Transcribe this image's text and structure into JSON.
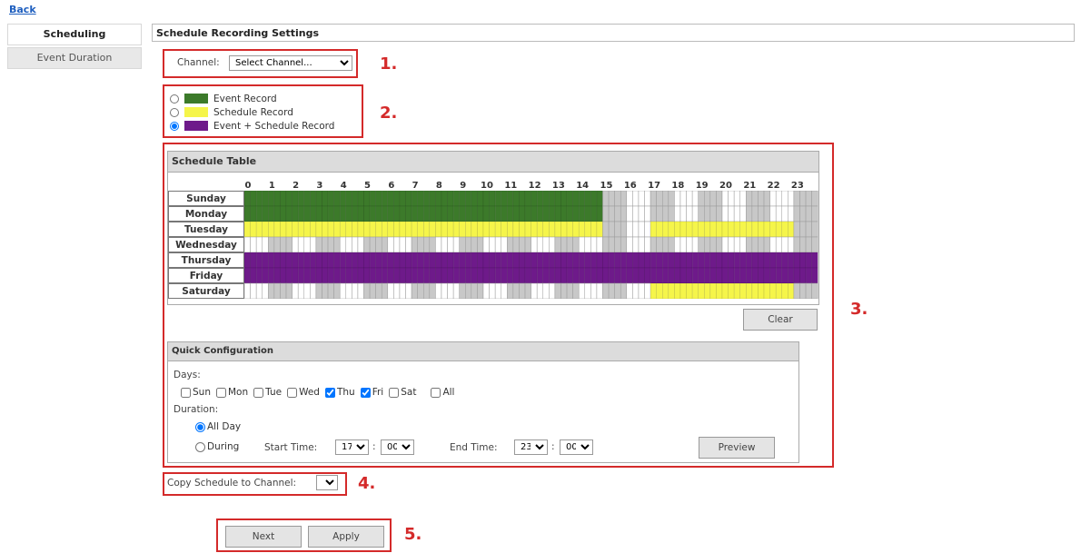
{
  "nav": {
    "back_label": "Back"
  },
  "sidebar": {
    "items": [
      {
        "label": "Scheduling",
        "active": true
      },
      {
        "label": "Event Duration",
        "active": false
      }
    ]
  },
  "page_title": "Schedule Recording Settings",
  "channel": {
    "label": "Channel:",
    "selected": "Select Channel..."
  },
  "legend": {
    "items": [
      {
        "label": "Event Record",
        "color": "#3c7a2a",
        "selected": false
      },
      {
        "label": "Schedule Record",
        "color": "#f5f54a",
        "selected": false
      },
      {
        "label": "Event + Schedule Record",
        "color": "#6e1a8a",
        "selected": true
      }
    ]
  },
  "schedule_table": {
    "title": "Schedule Table",
    "hours": [
      "0",
      "1",
      "2",
      "3",
      "4",
      "5",
      "6",
      "7",
      "8",
      "9",
      "10",
      "11",
      "12",
      "13",
      "14",
      "15",
      "16",
      "17",
      "18",
      "19",
      "20",
      "21",
      "22",
      "23"
    ],
    "days": [
      "Sunday",
      "Monday",
      "Tuesday",
      "Wednesday",
      "Thursday",
      "Friday",
      "Saturday"
    ],
    "colors": {
      "event": "#3c7a2a",
      "schedule": "#f5f54a",
      "both": "#6e1a8a",
      "empty_a": "#ffffff",
      "empty_b": "#c8c8c8"
    },
    "rows": [
      {
        "day": "Sunday",
        "segments": [
          {
            "type": "event",
            "start": 0,
            "end": 15
          }
        ]
      },
      {
        "day": "Monday",
        "segments": [
          {
            "type": "event",
            "start": 0,
            "end": 15
          }
        ]
      },
      {
        "day": "Tuesday",
        "segments": [
          {
            "type": "schedule",
            "start": 0,
            "end": 15
          },
          {
            "type": "schedule",
            "start": 17,
            "end": 23
          }
        ]
      },
      {
        "day": "Wednesday",
        "segments": []
      },
      {
        "day": "Thursday",
        "segments": [
          {
            "type": "both",
            "start": 0,
            "end": 24
          }
        ]
      },
      {
        "day": "Friday",
        "segments": [
          {
            "type": "both",
            "start": 0,
            "end": 24
          }
        ]
      },
      {
        "day": "Saturday",
        "segments": [
          {
            "type": "schedule",
            "start": 17,
            "end": 23
          }
        ]
      }
    ],
    "clear_label": "Clear"
  },
  "quick_config": {
    "title": "Quick Configuration",
    "days_label": "Days:",
    "days": [
      {
        "label": "Sun",
        "checked": false
      },
      {
        "label": "Mon",
        "checked": false
      },
      {
        "label": "Tue",
        "checked": false
      },
      {
        "label": "Wed",
        "checked": false
      },
      {
        "label": "Thu",
        "checked": true
      },
      {
        "label": "Fri",
        "checked": true
      },
      {
        "label": "Sat",
        "checked": false
      }
    ],
    "all_label": "All",
    "duration_label": "Duration:",
    "all_day_label": "All Day",
    "during_label": "During",
    "start_time_label": "Start Time:",
    "start_hour": "17",
    "start_min": "00",
    "end_time_label": "End Time:",
    "end_hour": "23",
    "end_min": "00",
    "preview_label": "Preview"
  },
  "copy": {
    "label": "Copy Schedule to Channel:",
    "selected": ""
  },
  "footer": {
    "next_label": "Next",
    "apply_label": "Apply"
  },
  "markers": [
    "1.",
    "2.",
    "3.",
    "4.",
    "5."
  ],
  "accent_red": "#d42a2a"
}
